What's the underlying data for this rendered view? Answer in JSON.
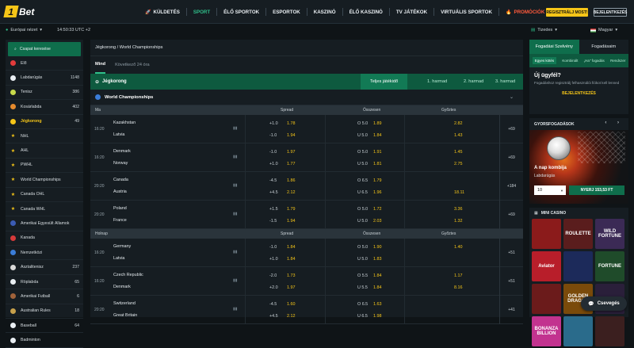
{
  "brand": {
    "logo_one": "1",
    "logo_text": "Bet"
  },
  "nav": [
    {
      "label": "KÜLDETÉS",
      "icon": "rocket-icon",
      "state": "normal"
    },
    {
      "label": "SPORT",
      "state": "active"
    },
    {
      "label": "ÉLŐ SPORTOK",
      "state": "normal"
    },
    {
      "label": "ESPORTOK",
      "state": "normal"
    },
    {
      "label": "KASZINÓ",
      "state": "normal"
    },
    {
      "label": "ÉLŐ KASZINÓ",
      "state": "normal"
    },
    {
      "label": "TV JÁTÉKOK",
      "state": "normal"
    },
    {
      "label": "VIRTUÁLIS SPORTOK",
      "state": "normal"
    },
    {
      "label": "PROMÓCIÓK",
      "icon": "flame-icon",
      "state": "promo"
    }
  ],
  "header": {
    "register": "REGISZTRÁLJ MOST!",
    "login": "BEJELENTKEZÉS"
  },
  "subbar": {
    "region": "Európai nézet",
    "time": "14:50:33 UTC +2",
    "odds_format": "Tizedes",
    "language": "Magyar"
  },
  "sidebar": {
    "quick": "Csapat keresése",
    "items": [
      {
        "label": "Élő",
        "count": "",
        "color": "#e23b3b",
        "type": "sport"
      },
      {
        "label": "Labdarúgás",
        "count": "1148",
        "color": "#e9eef2",
        "type": "sport"
      },
      {
        "label": "Tenisz",
        "count": "386",
        "color": "#c7d94b",
        "type": "sport"
      },
      {
        "label": "Kosárlabda",
        "count": "402",
        "color": "#e58a2d",
        "type": "sport"
      },
      {
        "label": "Jégkorong",
        "count": "49",
        "color": "#f5c518",
        "type": "active"
      },
      {
        "label": "NHL",
        "count": "",
        "type": "league"
      },
      {
        "label": "AHL",
        "count": "",
        "type": "league"
      },
      {
        "label": "PWHL",
        "count": "",
        "type": "league"
      },
      {
        "label": "World Championships",
        "count": "",
        "type": "league"
      },
      {
        "label": "Canada OHL",
        "count": "",
        "type": "league"
      },
      {
        "label": "Canada WHL",
        "count": "",
        "type": "league"
      },
      {
        "label": "Amerikai Egyesült Államok",
        "count": "",
        "color": "#3b5bb3",
        "type": "sport"
      },
      {
        "label": "Kanada",
        "count": "",
        "color": "#d63a3a",
        "type": "sport"
      },
      {
        "label": "Nemzetközi",
        "count": "",
        "color": "#3b7dd8",
        "type": "sport"
      },
      {
        "label": "Asztalitenisz",
        "count": "237",
        "color": "#d9d9d9",
        "type": "sport"
      },
      {
        "label": "Röplabda",
        "count": "65",
        "color": "#e9eef2",
        "type": "sport"
      },
      {
        "label": "Amerikai Futball",
        "count": "6",
        "color": "#a0623a",
        "type": "sport"
      },
      {
        "label": "Australian Rules",
        "count": "18",
        "color": "#c7a04b",
        "type": "sport"
      },
      {
        "label": "Baseball",
        "count": "64",
        "color": "#e9eef2",
        "type": "sport"
      },
      {
        "label": "Badminton",
        "count": "",
        "color": "#e9eef2",
        "type": "sport"
      }
    ]
  },
  "main": {
    "breadcrumb": "Jégkorong / World Championships",
    "filters": [
      {
        "label": "Mind",
        "on": true
      },
      {
        "label": "Következő 24 óra",
        "on": false
      }
    ],
    "sport": "Jégkorong",
    "periods": [
      {
        "label": "Teljes játékidő",
        "on": true
      },
      {
        "label": "1. harmad",
        "on": false
      },
      {
        "label": "2. harmad",
        "on": false
      },
      {
        "label": "3. harmad",
        "on": false
      }
    ],
    "championship": "World Championships",
    "col_spread": "Spread",
    "col_total": "Összesen",
    "col_winner": "Győztes",
    "groups": [
      {
        "day": "Ma",
        "matches": [
          {
            "time": "16:20",
            "home": "Kazakhstan",
            "away": "Latvia",
            "sp": [
              [
                "+1.0",
                "1.78"
              ],
              [
                "-1.0",
                "1.94"
              ]
            ],
            "tot": [
              [
                "O 5.0",
                "1.89"
              ],
              [
                "U 5.0",
                "1.84"
              ]
            ],
            "win": [
              "2.82",
              "1.43"
            ],
            "more": "+69"
          },
          {
            "time": "16:20",
            "home": "Denmark",
            "away": "Norway",
            "sp": [
              [
                "-1.0",
                "1.97"
              ],
              [
                "+1.0",
                "1.77"
              ]
            ],
            "tot": [
              [
                "O 5.0",
                "1.91"
              ],
              [
                "U 5.0",
                "1.81"
              ]
            ],
            "win": [
              "1.45",
              "2.75"
            ],
            "more": "+69"
          },
          {
            "time": "20:20",
            "home": "Canada",
            "away": "Austria",
            "sp": [
              [
                "-4.5",
                "1.86"
              ],
              [
                "+4.5",
                "2.12"
              ]
            ],
            "tot": [
              [
                "O 6.5",
                "1.79"
              ],
              [
                "U 6.5",
                "1.96"
              ]
            ],
            "win": [
              "",
              "18.11"
            ],
            "more": "+184"
          },
          {
            "time": "20:20",
            "home": "Poland",
            "away": "France",
            "sp": [
              [
                "+1.5",
                "1.79"
              ],
              [
                "-1.5",
                "1.94"
              ]
            ],
            "tot": [
              [
                "O 5.0",
                "1.72"
              ],
              [
                "U 5.0",
                "2.03"
              ]
            ],
            "win": [
              "3.36",
              "1.32"
            ],
            "more": "+69"
          }
        ]
      },
      {
        "day": "Holnap",
        "matches": [
          {
            "time": "16:20",
            "home": "Germany",
            "away": "Latvia",
            "sp": [
              [
                "-1.0",
                "1.84"
              ],
              [
                "+1.0",
                "1.84"
              ]
            ],
            "tot": [
              [
                "O 5.0",
                "1.90"
              ],
              [
                "U 5.0",
                "1.83"
              ]
            ],
            "win": [
              "1.40",
              ""
            ],
            "more": "+51"
          },
          {
            "time": "16:20",
            "home": "Czech Republic",
            "away": "Denmark",
            "sp": [
              [
                "-2.0",
                "1.73"
              ],
              [
                "+2.0",
                "1.97"
              ]
            ],
            "tot": [
              [
                "O 5.5",
                "1.84"
              ],
              [
                "U 5.5",
                "1.84"
              ]
            ],
            "win": [
              "1.17",
              "8.16"
            ],
            "more": "+51"
          },
          {
            "time": "20:20",
            "home": "Switzerland",
            "away": "Great Britain",
            "sp": [
              [
                "-4.5",
                "1.60"
              ],
              [
                "+4.5",
                "2.12"
              ]
            ],
            "tot": [
              [
                "O 6.5",
                "1.63"
              ],
              [
                "U 6.5",
                "1.98"
              ]
            ],
            "win": [
              "",
              ""
            ],
            "more": "+41"
          }
        ]
      }
    ]
  },
  "right": {
    "tabs": [
      {
        "label": "Fogadási Szelvény",
        "on": true
      },
      {
        "label": "Fogadásaim",
        "on": false
      }
    ],
    "subtabs": [
      {
        "label": "Egyes kötés",
        "on": true
      },
      {
        "label": "Kombinált",
        "on": false
      },
      {
        "label": "„Ha\" fogadás",
        "on": false
      },
      {
        "label": "Rendszer",
        "on": false
      }
    ],
    "question": "Új ügyfél?",
    "text": "Fogadáshoz regisztrálj felhasználói fiókot kell lenned",
    "login": "BEJELENTKEZÉS",
    "quick_title": "GYORSFOGADÁSOK",
    "combo_title": "A nap kombija",
    "combo_sport": "Labdarúgás",
    "stake": "10",
    "bet_label": "NYERJ 153,53 FT",
    "casino_title": "MINI CASINO",
    "tiles": [
      {
        "label": "",
        "bg": "#8b1b1b"
      },
      {
        "label": "ROULETTE",
        "bg": "#5a1d1d"
      },
      {
        "label": "WILD FORTUNE",
        "bg": "#3b2a55"
      },
      {
        "label": "Aviator",
        "bg": "#b81e2a"
      },
      {
        "label": "",
        "bg": "#1c2a5a"
      },
      {
        "label": "FORTUNE",
        "bg": "#1f4b2a"
      },
      {
        "label": "",
        "bg": "#6b1b1b"
      },
      {
        "label": "GOLDEN DRAGON",
        "bg": "#7a4a0a"
      },
      {
        "label": "",
        "bg": "#2a1f3a"
      },
      {
        "label": "BONANZA BILLION",
        "bg": "#c2338f"
      },
      {
        "label": "",
        "bg": "#2a6b8b"
      },
      {
        "label": "",
        "bg": "#3b1f1f"
      }
    ],
    "chat": "Csevegés"
  }
}
